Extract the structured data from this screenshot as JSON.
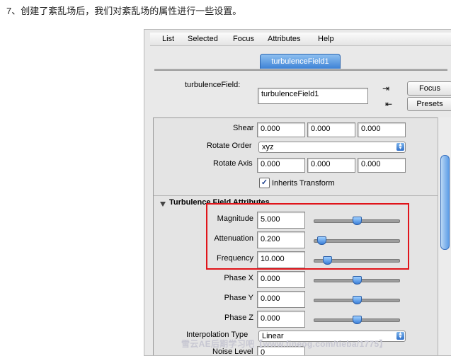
{
  "caption": "7、创建了紊乱场后，我们对紊乱场的属性进行一些设置。",
  "menu": [
    "List",
    "Selected",
    "Focus",
    "Attributes",
    "Help"
  ],
  "tab": {
    "label": "turbulenceField1"
  },
  "node": {
    "label": "turbulenceField:",
    "value": "turbulenceField1"
  },
  "buttons": {
    "focus": "Focus",
    "presets": "Presets"
  },
  "icons": {
    "load": "load-attributes-icon",
    "save": "save-attributes-icon"
  },
  "transform": {
    "shear_label": "Shear",
    "shear": [
      "0.000",
      "0.000",
      "0.000"
    ],
    "rotate_order_label": "Rotate Order",
    "rotate_order": "xyz",
    "rotate_axis_label": "Rotate Axis",
    "rotate_axis": [
      "0.000",
      "0.000",
      "0.000"
    ],
    "inherits_label": "Inherits Transform",
    "inherits_checked": true
  },
  "section": {
    "title": "Turbulence Field Attributes"
  },
  "attributes": [
    {
      "label": "Magnitude",
      "value": "5.000",
      "slider": 0.5
    },
    {
      "label": "Attenuation",
      "value": "0.200",
      "slider": 0.05
    },
    {
      "label": "Frequency",
      "value": "10.000",
      "slider": 0.12
    },
    {
      "label": "Phase X",
      "value": "0.000",
      "slider": 0.5
    },
    {
      "label": "Phase Y",
      "value": "0.000",
      "slider": 0.5
    },
    {
      "label": "Phase Z",
      "value": "0.000",
      "slider": 0.5
    }
  ],
  "interpolation": {
    "label": "Interpolation Type",
    "value": "Linear"
  },
  "noise": {
    "label": "Noise Level",
    "value": "0"
  },
  "watermark": "雪云AE后期学习吧【www.fineog.com/tieba/1775】",
  "colors": {
    "highlight_box": "#e0141a",
    "tab": "#3d82d6"
  }
}
